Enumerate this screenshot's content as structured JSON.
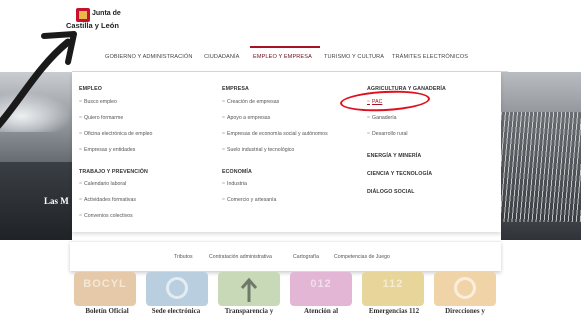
{
  "header": {
    "logo_line1": "Junta de",
    "logo_line2": "Castilla y León"
  },
  "nav": {
    "items": [
      {
        "label": "GOBIERNO Y ADMINISTRACIÓN"
      },
      {
        "label": "CIUDADANÍA"
      },
      {
        "label": "EMPLEO Y EMPRESA"
      },
      {
        "label": "TURISMO Y CULTURA"
      },
      {
        "label": "TRÁMITES ELECTRÓNICOS"
      }
    ],
    "active": "EMPLEO Y EMPRESA"
  },
  "mega_menu": {
    "col1": {
      "section1_title": "EMPLEO",
      "section1_links": [
        "Busco empleo",
        "Quiero formarme",
        "Oficina electrónica de empleo",
        "Empresas y entidades"
      ],
      "section2_title": "TRABAJO Y PREVENCIÓN",
      "section2_links": [
        "Calendario laboral",
        "Actividades formativas",
        "Convenios colectivos"
      ]
    },
    "col2": {
      "section1_title": "EMPRESA",
      "section1_links": [
        "Creación de empresas",
        "Apoyo a empresas",
        "Empresas de economía social y autónomos",
        "Suelo industrial y tecnológico"
      ],
      "section2_title": "ECONOMÍA",
      "section2_links": [
        "Industria",
        "Comercio y artesanía"
      ]
    },
    "col3": {
      "section1_title": "AGRICULTURA Y GANADERÍA",
      "section1_links": [
        "PAC",
        "Ganadería",
        "Desarrollo rural"
      ],
      "section2_title": "ENERGÍA Y MINERÍA",
      "section3_title": "CIENCIA Y TECNOLOGÍA",
      "section4_title": "DIÁLOGO SOCIAL"
    }
  },
  "photo_caption": "Las M",
  "footer_links": [
    "Tributos",
    "Contratación administrativa",
    "Cartografía",
    "Competencias de Juego"
  ],
  "tiles": [
    {
      "word": "BOCYL",
      "label": "Boletín Oficial",
      "color": "#e6c9a8"
    },
    {
      "word": "",
      "label": "Sede electrónica",
      "color": "#b9cfe0"
    },
    {
      "word": "",
      "label": "Transparencia y",
      "color": "#c8d9b8"
    },
    {
      "word": "012",
      "label": "Atención al",
      "color": "#e2b6d4"
    },
    {
      "word": "112",
      "label": "Emergencias 112",
      "color": "#e8d59a"
    },
    {
      "word": "",
      "label": "Direcciones y",
      "color": "#f0d4a8"
    }
  ],
  "colors": {
    "accent": "#a31321",
    "annotation": "#e0101e"
  }
}
